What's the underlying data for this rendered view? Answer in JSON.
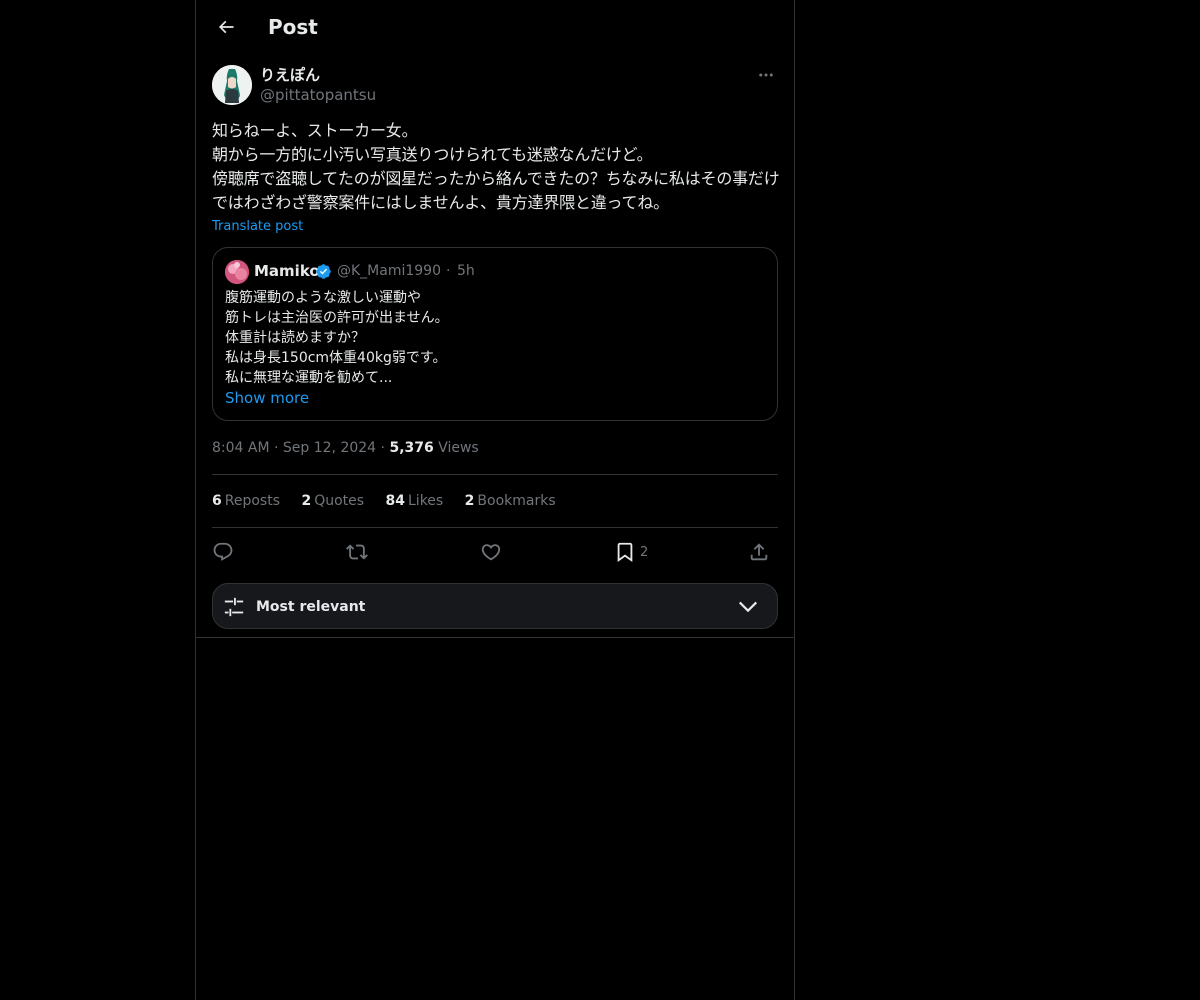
{
  "header": {
    "title": "Post",
    "back_icon": "arrow-left-icon"
  },
  "post": {
    "author_name": "りえぽん",
    "author_handle": "@pittatopantsu",
    "text": "知らねーよ、ストーカー女。\n朝から一方的に小汚い写真送りつけられても迷惑なんだけど。\n傍聴席で盗聴してたのが図星だったから絡んできたの？ちなみに私はその事だけではわざわざ警察案件にはしませんよ、貴方達界隈と違ってね。",
    "translate_label": "Translate post",
    "time": "8:04 AM",
    "date": "Sep 12, 2024",
    "views_count": "5,376",
    "views_label": "Views"
  },
  "quote": {
    "name": "Mamiko",
    "handle": "@K_Mami1990",
    "separator": "·",
    "time": "5h",
    "text": "腹筋運動のような激しい運動や\n筋トレは主治医の許可が出ません。\n体重計は読めますか？\n私は身長150cm体重40kg弱です。\n私に無理な運動を勧めて...",
    "show_more": "Show more"
  },
  "stats": {
    "reposts_count": "6",
    "reposts_label": "Reposts",
    "quotes_count": "2",
    "quotes_label": "Quotes",
    "likes_count": "84",
    "likes_label": "Likes",
    "bookmarks_count": "2",
    "bookmarks_label": "Bookmarks"
  },
  "actions": {
    "bookmark_count": "2"
  },
  "sort": {
    "label": "Most relevant"
  },
  "colors": {
    "background": "#000000",
    "text": "#e7e9ea",
    "muted": "#71767b",
    "accent": "#1d9bf0",
    "border": "#2f3336",
    "verified": "#1d9bf0"
  }
}
